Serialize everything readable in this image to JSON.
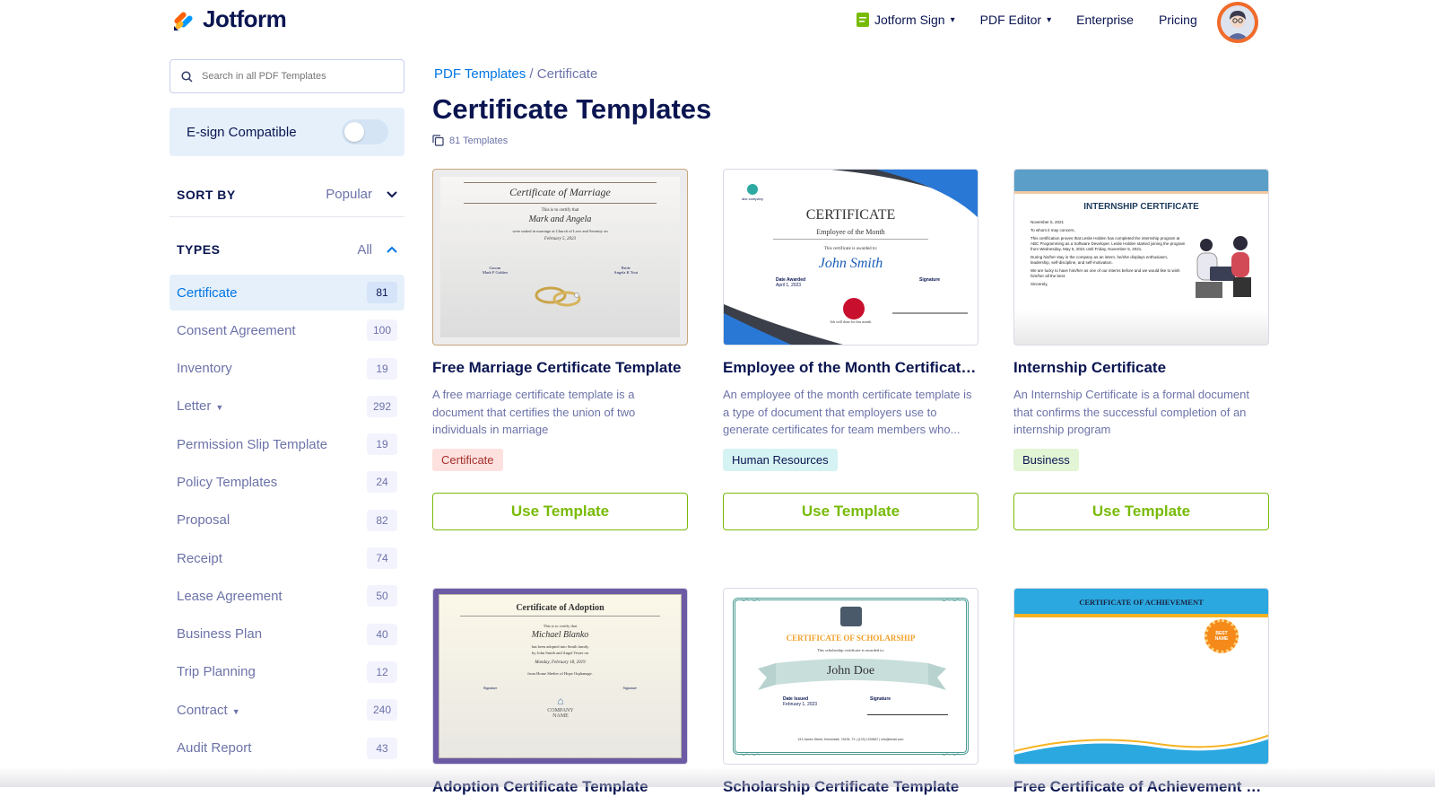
{
  "header": {
    "logo_text": "Jotform",
    "nav": [
      {
        "label": "Jotform Sign",
        "has_caret": true
      },
      {
        "label": "PDF Editor",
        "has_caret": true
      },
      {
        "label": "Enterprise",
        "has_caret": false
      },
      {
        "label": "Pricing",
        "has_caret": false
      }
    ]
  },
  "sidebar": {
    "search_placeholder": "Search in all PDF Templates",
    "esign_label": "E-sign Compatible",
    "sort_label": "SORT BY",
    "sort_value": "Popular",
    "types_label": "TYPES",
    "types_value": "All",
    "types": [
      {
        "label": "Certificate",
        "count": "81"
      },
      {
        "label": "Consent Agreement",
        "count": "100"
      },
      {
        "label": "Inventory",
        "count": "19"
      },
      {
        "label": "Letter",
        "count": "292"
      },
      {
        "label": "Permission Slip Template",
        "count": "19"
      },
      {
        "label": "Policy Templates",
        "count": "24"
      },
      {
        "label": "Proposal",
        "count": "82"
      },
      {
        "label": "Receipt",
        "count": "74"
      },
      {
        "label": "Lease Agreement",
        "count": "50"
      },
      {
        "label": "Business Plan",
        "count": "40"
      },
      {
        "label": "Trip Planning",
        "count": "12"
      },
      {
        "label": "Contract",
        "count": "240"
      },
      {
        "label": "Audit Report",
        "count": "43"
      }
    ]
  },
  "main": {
    "breadcrumb_root": "PDF Templates",
    "breadcrumb_sep": " / ",
    "breadcrumb_current": "Certificate",
    "title": "Certificate Templates",
    "template_count": "81 Templates",
    "use_label": "Use Template",
    "cards": [
      {
        "title": "Free Marriage Certificate Template",
        "desc": "A free marriage certificate template is a document that certifies the union of two individuals in marriage",
        "tag": "Certificate",
        "tag_bg": "#fde1df",
        "tag_fg": "#a3302b",
        "thumb": {
          "heading": "Certificate of Marriage",
          "sub": "This is to certify that",
          "names": "Mark and Angela",
          "line": "were united in marriage at Church of Love and Serenity on",
          "date": "February 5, 2023",
          "left": "Groom",
          "left_name": "Mark F Golden",
          "right": "Bride",
          "right_name": "Angela K Tout"
        }
      },
      {
        "title": "Employee of the Month Certificate Template",
        "desc": "An employee of the month certificate template is a type of document that employers use to generate certificates for team members who...",
        "tag": "Human Resources",
        "tag_bg": "#d6f3f3",
        "tag_fg": "#0a1551",
        "thumb": {
          "heading": "CERTIFICATE",
          "sub": "Employee of the Month",
          "line": "This certificate is awarded to:",
          "name": "John Smith",
          "left": "Date Awarded",
          "left_val": "April 1, 2023",
          "right": "Signature",
          "footer": "Job well done for this month",
          "logo": "abc company"
        }
      },
      {
        "title": "Internship Certificate",
        "desc": "An Internship Certificate is a formal document that confirms the successful completion of an internship program",
        "tag": "Business",
        "tag_bg": "#e2f5d5",
        "tag_fg": "#0a1551",
        "thumb": {
          "heading": "INTERNSHIP CERTIFICATE",
          "date": "November 5, 2021",
          "to": "To whom it may concern,",
          "body": "This certification proves that Leslie Holden has completed the internship program at ABC Programming as a Software Developer. Leslie Holden started joining the program from Wednesday, May 5, 2021 until Friday, November 5, 2021.",
          "body2": "During his/her stay in the company as an intern, he/she displays enthusiasm, leadership, self-discipline, and self-motivation.",
          "body3": "We are lucky to have him/her as one of our interns before and we would like to wish him/her all the best.",
          "sign": "Sincerely,"
        }
      },
      {
        "title": "Adoption Certificate Template",
        "thumb": {
          "heading": "Certificate of Adoption",
          "sub": "This is to certify that",
          "name": "Michael Blanko",
          "line1": "has been adopted into Smith family",
          "line2": "by John Smith and Angel Tester on",
          "date": "Monday, February 18, 2019",
          "line3": "from Home Shelter of Hope Orphanage.",
          "left": "Signature",
          "right": "Signature",
          "logo1": "COMPANY",
          "logo2": "NAME"
        }
      },
      {
        "title": "Scholarship Certificate Template",
        "thumb": {
          "heading": "CERTIFICATE OF SCHOLARSHIP",
          "line": "This scholarship certificate is awarded to:",
          "name": "John Doe",
          "left": "Date Issued",
          "left_val": "February 1, 2023",
          "right": "Signature",
          "address": "413 James Street, Kennedale, 76135, TX | (123) 1234567 | info@email.com"
        }
      },
      {
        "title": "Free Certificate of Achievement Template",
        "thumb": {
          "heading": "CERTIFICATE OF ACHIEVEMENT",
          "badge1": "BEST",
          "badge2": "NAME"
        }
      }
    ]
  }
}
